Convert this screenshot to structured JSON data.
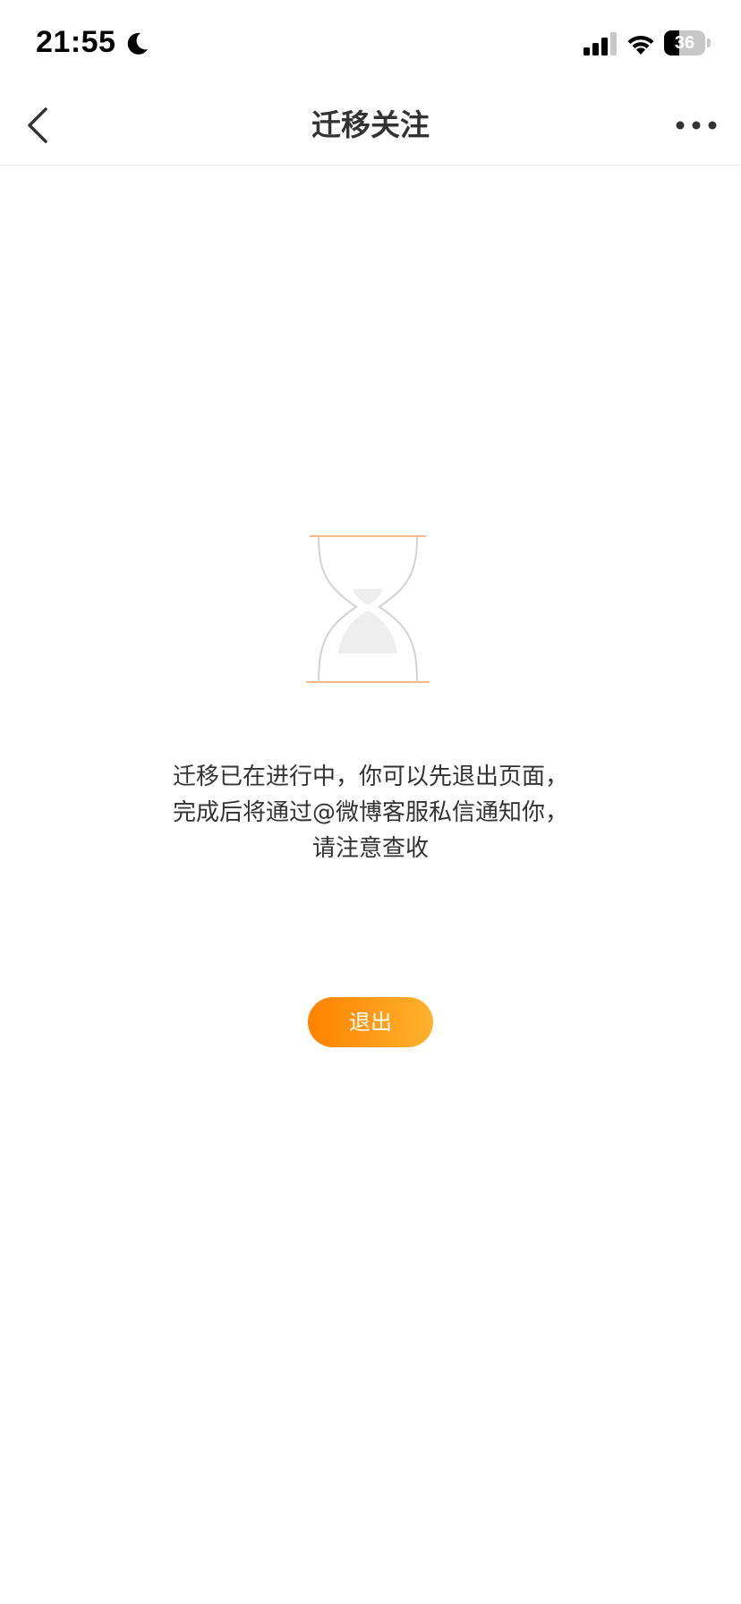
{
  "status_bar": {
    "time": "21:55",
    "battery_level": "36",
    "battery_fraction": 0.36,
    "icons": {
      "focus": "moon-icon",
      "signal": "signal-icon",
      "wifi": "wifi-icon",
      "battery": "battery-icon"
    }
  },
  "nav": {
    "title": "迁移关注",
    "back_icon": "chevron-left-icon",
    "more_icon": "more-dots-icon"
  },
  "content": {
    "illustration": "hourglass-icon",
    "message_lines": [
      "迁移已在进行中，你可以先退出页面，",
      "完成后将通过@微博客服私信通知你，",
      "请注意查收"
    ],
    "exit_label": "退出"
  },
  "colors": {
    "accent_start": "#ff8200",
    "accent_end": "#ffb22c",
    "title_text": "#333333",
    "hourglass_line": "#f5b88a",
    "hourglass_body": "#d2d2d2",
    "hourglass_sand": "#eeeeee"
  }
}
